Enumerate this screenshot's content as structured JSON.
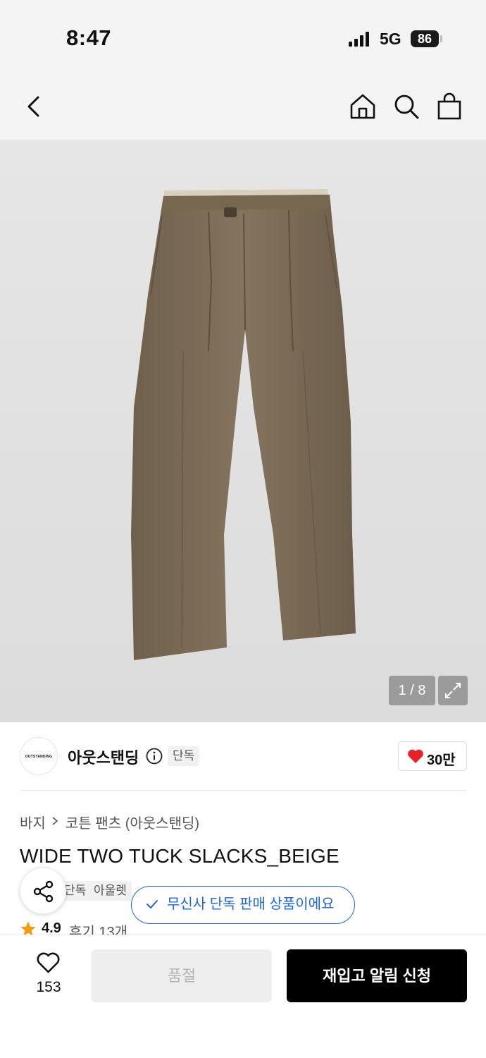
{
  "status_bar": {
    "time": "8:47",
    "network": "5G",
    "battery": "86"
  },
  "nav": {
    "icons": [
      "back-icon",
      "home-icon",
      "search-icon",
      "shopping-bag-icon"
    ]
  },
  "gallery": {
    "counter": "1 / 8",
    "image_subject": "olive-brown two-tuck wide slacks",
    "image_bg": "#e2e2e2",
    "garment_color": "#7b6b56"
  },
  "brand": {
    "logo_text": "OUTSTANDING",
    "name": "아웃스탠딩",
    "tag": "단독",
    "likes": "30만"
  },
  "breadcrumb": {
    "items": [
      "바지",
      "코튼 팬츠 (아웃스탠딩)"
    ]
  },
  "product": {
    "title": "WIDE TWO TUCK SLACKS_BEIGE",
    "tags": [
      "단독",
      "아울렛"
    ],
    "exclusive_notice": "무신사 단독 판매 상품이에요",
    "rating": "4.9",
    "reviews": "후기 13개"
  },
  "bottom_bar": {
    "wish_count": "153",
    "soldout_label": "품절",
    "restock_label": "재입고 알림 신청"
  },
  "colors": {
    "accent_blue": "#1e63e6",
    "heart_red": "#e8202a",
    "star_orange": "#f39c12",
    "cta_black": "#000000"
  }
}
